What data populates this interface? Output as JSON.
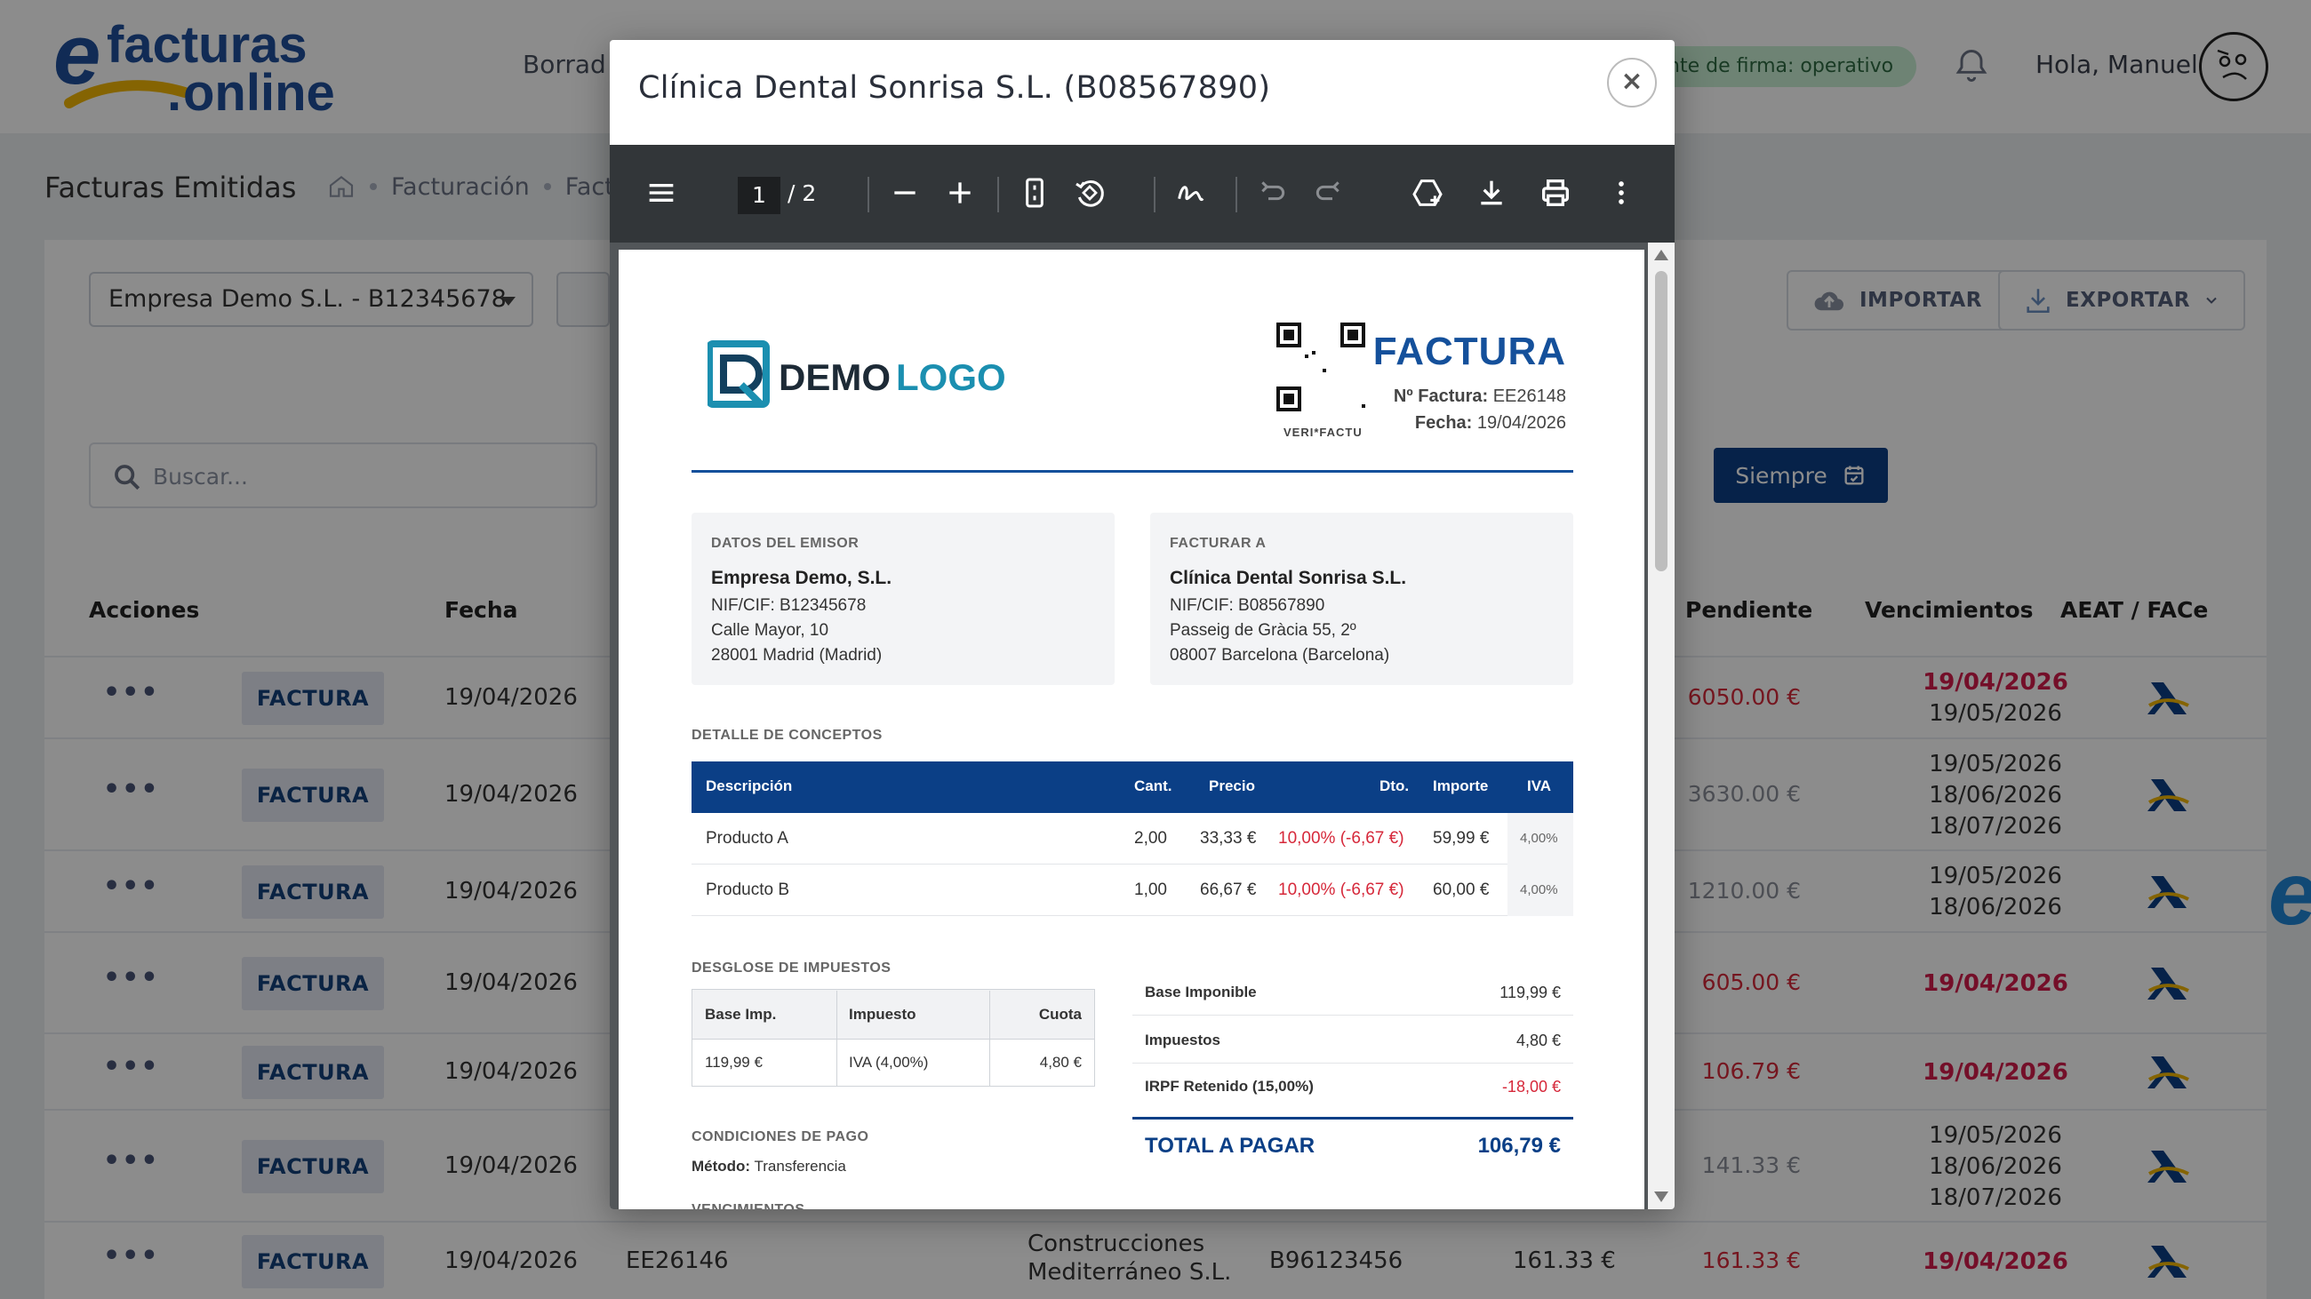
{
  "header": {
    "brand_top": "facturas",
    "brand_bottom": "online",
    "nav_item": "Borrad",
    "status": "nte de firma: operativo",
    "greeting": "Hola, Manuel"
  },
  "page": {
    "title": "Facturas Emitidas",
    "breadcrumb": [
      "Facturación",
      "Factu"
    ]
  },
  "toolbar": {
    "company_selected": "Empresa Demo S.L. - B12345678",
    "import_label": "IMPORTAR",
    "export_label": "EXPORTAR",
    "search_placeholder": "Buscar...",
    "range_label": "Siempre"
  },
  "table": {
    "headers": {
      "actions": "Acciones",
      "date": "Fecha",
      "pending": "Pendiente",
      "due": "Vencimientos",
      "aeat": "AEAT / FACe"
    },
    "rows": [
      {
        "type": "FACTURA",
        "date": "19/04/2026",
        "pending": "6050.00 €",
        "pending_color": "#d6283a",
        "due": [
          "19/04/2026",
          "19/05/2026"
        ],
        "due_red": [
          true,
          false
        ]
      },
      {
        "type": "FACTURA",
        "date": "19/04/2026",
        "pending": "3630.00 €",
        "pending_color": "#8a8f99",
        "due": [
          "19/05/2026",
          "18/06/2026",
          "18/07/2026"
        ],
        "due_red": [
          false,
          false,
          false
        ]
      },
      {
        "type": "FACTURA",
        "date": "19/04/2026",
        "pending": "1210.00 €",
        "pending_color": "#8a8f99",
        "due": [
          "19/05/2026",
          "18/06/2026"
        ],
        "due_red": [
          false,
          false
        ]
      },
      {
        "type": "FACTURA",
        "date": "19/04/2026",
        "pending": "605.00 €",
        "pending_color": "#d6283a",
        "due": [
          "19/04/2026"
        ],
        "due_red": [
          true
        ]
      },
      {
        "type": "FACTURA",
        "date": "19/04/2026",
        "pending": "106.79 €",
        "pending_color": "#d6283a",
        "due": [
          "19/04/2026"
        ],
        "due_red": [
          true
        ]
      },
      {
        "type": "FACTURA",
        "date": "19/04/2026",
        "pending": "141.33 €",
        "pending_color": "#8a8f99",
        "due": [
          "19/05/2026",
          "18/06/2026",
          "18/07/2026"
        ],
        "due_red": [
          false,
          false,
          false
        ]
      },
      {
        "type": "FACTURA",
        "date": "19/04/2026",
        "number": "EE26146",
        "client": [
          "Construcciones",
          "Mediterráneo S.L."
        ],
        "nif": "B96123456",
        "total": "161.33 €",
        "pending": "161.33 €",
        "pending_color": "#d6283a",
        "due": [
          "19/04/2026"
        ],
        "due_red": [
          true
        ]
      }
    ]
  },
  "modal": {
    "title": "Clínica Dental Sonrisa S.L. (B08567890)",
    "close": "×",
    "viewer": {
      "page_current": "1",
      "page_total": "/ 2"
    },
    "invoice": {
      "logo_left": "DEMO",
      "logo_right": "LOGO",
      "qr_label": "VERI*FACTU",
      "doc_title": "FACTURA",
      "number_label": "Nº Factura:",
      "number": "EE26148",
      "date_label": "Fecha:",
      "date": "19/04/2026",
      "issuer": {
        "label": "DATOS DEL EMISOR",
        "name": "Empresa Demo, S.L.",
        "lines": [
          "NIF/CIF: B12345678",
          "Calle Mayor, 10",
          "28001 Madrid (Madrid)"
        ]
      },
      "bill_to": {
        "label": "FACTURAR A",
        "name": "Clínica Dental Sonrisa S.L.",
        "lines": [
          "NIF/CIF: B08567890",
          "Passeig de Gràcia 55, 2º",
          "08007 Barcelona (Barcelona)"
        ]
      },
      "concepts_label": "DETALLE DE CONCEPTOS",
      "columns": {
        "desc": "Descripción",
        "qty": "Cant.",
        "price": "Precio",
        "disc": "Dto.",
        "amount": "Importe",
        "vat": "IVA"
      },
      "lines": [
        {
          "desc": "Producto A",
          "qty": "2,00",
          "price": "33,33 €",
          "disc": "10,00% (-6,67 €)",
          "amount": "59,99 €",
          "vat": "4,00%"
        },
        {
          "desc": "Producto B",
          "qty": "1,00",
          "price": "66,67 €",
          "disc": "10,00% (-6,67 €)",
          "amount": "60,00 €",
          "vat": "4,00%"
        }
      ],
      "tax_label": "DESGLOSE DE IMPUESTOS",
      "tax_headers": {
        "base": "Base Imp.",
        "tax": "Impuesto",
        "quota": "Cuota"
      },
      "tax_row": {
        "base": "119,99 €",
        "tax": "IVA (4,00%)",
        "quota": "4,80 €"
      },
      "totals": {
        "base_label": "Base Imponible",
        "base": "119,99 €",
        "taxes_label": "Impuestos",
        "taxes": "4,80 €",
        "irpf_label": "IRPF Retenido (15,00%)",
        "irpf": "-18,00 €",
        "total_label": "TOTAL A PAGAR",
        "total": "106,79 €"
      },
      "payment_label": "CONDICIONES DE PAGO",
      "payment_method_label": "Método:",
      "payment_method": "Transferencia",
      "due_label": "VENCIMIENTOS"
    }
  },
  "colors": {
    "primary": "#0b3f86",
    "danger": "#d31c4b",
    "brand_blue": "#1f4f9c",
    "brand_yellow": "#f2b705"
  }
}
